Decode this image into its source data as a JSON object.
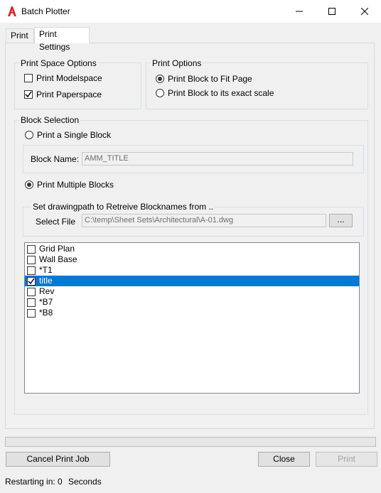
{
  "window": {
    "title": "Batch Plotter",
    "minimize": "—",
    "maximize": "☐",
    "close": "✕"
  },
  "tabs": [
    {
      "label": "Print",
      "active": false
    },
    {
      "label": "Print Settings",
      "active": true
    }
  ],
  "print_space_options": {
    "legend": "Print Space Options",
    "modelspace": {
      "label": "Print Modelspace",
      "checked": false
    },
    "paperspace": {
      "label": "Print Paperspace",
      "checked": true
    }
  },
  "print_options": {
    "legend": "Print Options",
    "fit_page": {
      "label": "Print Block to Fit Page",
      "selected": true
    },
    "exact_scale": {
      "label": "Print Block to its exact scale",
      "selected": false
    }
  },
  "block_selection": {
    "legend": "Block Selection",
    "single": {
      "label": "Print a Single Block",
      "selected": false
    },
    "block_name_label": "Block Name:",
    "block_name_value": "AMM_TITLE",
    "multiple": {
      "label": "Print Multiple Blocks",
      "selected": true
    },
    "drawingpath_legend": "Set drawingpath to Retreive Blocknames from ..",
    "select_file_label": "Select File",
    "select_file_value": "C:\\temp\\Sheet Sets\\Architectural\\A-01.dwg",
    "browse_label": "...",
    "blocks": [
      {
        "name": "Grid Plan",
        "checked": false,
        "selected": false
      },
      {
        "name": "Wall Base",
        "checked": false,
        "selected": false
      },
      {
        "name": "*T1",
        "checked": false,
        "selected": false
      },
      {
        "name": "title",
        "checked": true,
        "selected": true
      },
      {
        "name": "Rev",
        "checked": false,
        "selected": false
      },
      {
        "name": "*B7",
        "checked": false,
        "selected": false
      },
      {
        "name": "*B8",
        "checked": false,
        "selected": false
      }
    ]
  },
  "progress": 0,
  "buttons": {
    "cancel": "Cancel Print Job",
    "close": "Close",
    "print": "Print"
  },
  "status": {
    "label": "Restarting in:",
    "value": "0",
    "unit": "Seconds"
  },
  "colors": {
    "accent": "#0078d7",
    "app_icon": "#d9262a"
  }
}
